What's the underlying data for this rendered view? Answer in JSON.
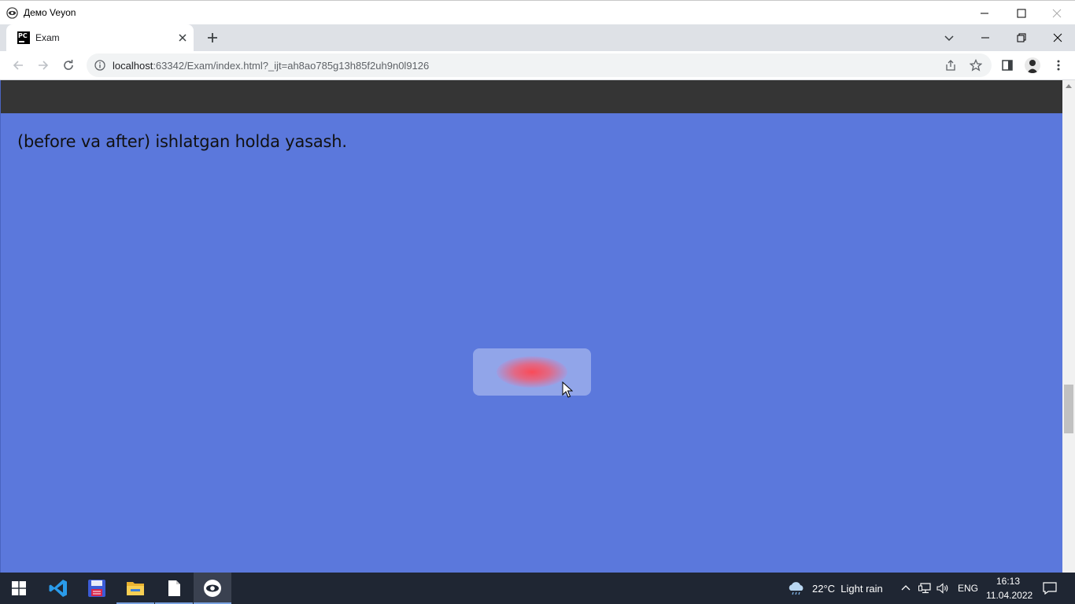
{
  "veyon": {
    "title": "Демо Veyon",
    "logo_icon": "veyon-eye-icon"
  },
  "browser": {
    "tabs": [
      {
        "title": "Exam",
        "favicon": "pycharm-icon",
        "active": true
      }
    ],
    "url": {
      "host": "localhost",
      "rest": ":63342/Exam/index.html?_ijt=ah8ao785g13h85f2uh9n0l9126"
    }
  },
  "page": {
    "text": "(before va after) ishlatgan holda yasash.",
    "background_color": "#5b78dc",
    "header_color": "#353535",
    "blob_color": "#ff4650"
  },
  "taskbar": {
    "apps": [
      {
        "name": "start-button",
        "icon": "windows-icon"
      },
      {
        "name": "vscode",
        "icon": "vscode-icon"
      },
      {
        "name": "save-app",
        "icon": "floppy-disk-icon"
      },
      {
        "name": "file-explorer",
        "icon": "folder-icon"
      },
      {
        "name": "notepad",
        "icon": "document-icon"
      },
      {
        "name": "veyon",
        "icon": "veyon-eye-icon"
      }
    ],
    "weather": {
      "temp": "22°C",
      "condition": "Light rain",
      "icon": "cloud-rain-icon"
    },
    "language": "ENG",
    "time": "16:13",
    "date": "11.04.2022"
  }
}
